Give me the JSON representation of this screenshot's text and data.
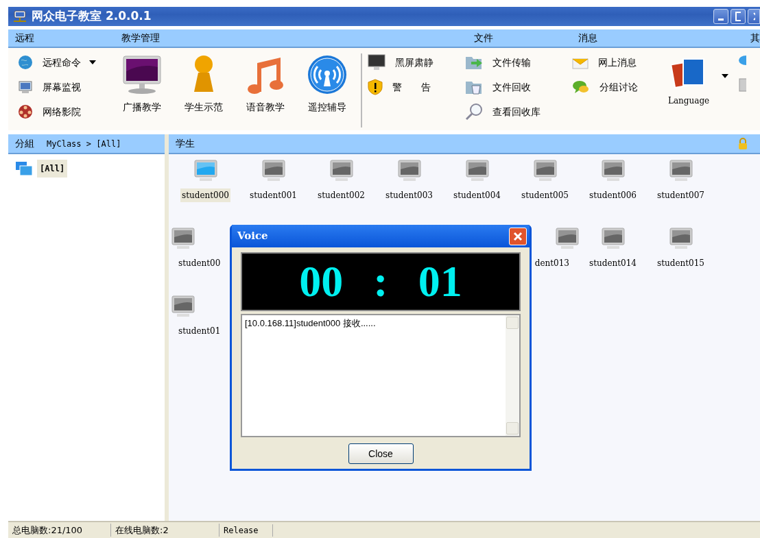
{
  "window": {
    "title": "网众电子教室 2.0.0.1"
  },
  "menu": [
    {
      "label": "远程"
    },
    {
      "label": "教学管理"
    },
    {
      "label": "文件"
    },
    {
      "label": "消息"
    },
    {
      "label": "其"
    }
  ],
  "toolbar": {
    "remote": [
      {
        "label": "远程命令",
        "dropdown": true
      },
      {
        "label": "屏幕监视",
        "dropdown": false
      },
      {
        "label": "网络影院",
        "dropdown": false
      }
    ],
    "teaching": [
      {
        "label": "广播教学"
      },
      {
        "label": "学生示范"
      },
      {
        "label": "语音教学"
      },
      {
        "label": "遥控辅导"
      }
    ],
    "control": [
      {
        "label": "黑屏肃静"
      },
      {
        "label": "警　　告"
      }
    ],
    "file": [
      {
        "label": "文件传输"
      },
      {
        "label": "文件回收"
      },
      {
        "label": "查看回收库"
      }
    ],
    "message": [
      {
        "label": "网上消息"
      },
      {
        "label": "分组讨论"
      }
    ],
    "language": {
      "label": "Language",
      "dropdown": true
    }
  },
  "group_panel": {
    "title": "分組",
    "path": "MyClass > [All]",
    "tree": [
      {
        "label": "[All]",
        "selected": true
      }
    ]
  },
  "student_panel": {
    "title": "学生",
    "rows": [
      [
        {
          "label": "student000",
          "online": true,
          "selected": true
        },
        {
          "label": "student001",
          "online": false,
          "selected": false
        },
        {
          "label": "student002",
          "online": false,
          "selected": false
        },
        {
          "label": "student003",
          "online": false,
          "selected": false
        },
        {
          "label": "student004",
          "online": false,
          "selected": false
        },
        {
          "label": "student005",
          "online": false,
          "selected": false
        },
        {
          "label": "student006",
          "online": false,
          "selected": false
        },
        {
          "label": "student007",
          "online": false,
          "selected": false
        }
      ],
      [
        {
          "label": "student00",
          "online": false,
          "selected": false
        },
        null,
        null,
        null,
        null,
        {
          "label": "dent013",
          "online": false,
          "selected": false
        },
        {
          "label": "student014",
          "online": false,
          "selected": false
        },
        {
          "label": "student015",
          "online": false,
          "selected": false
        }
      ],
      [
        {
          "label": "student01",
          "online": false,
          "selected": false
        }
      ]
    ]
  },
  "dialog": {
    "title": "Voice",
    "timer": {
      "minutes": "00",
      "separator": ":",
      "seconds": "01"
    },
    "log": "[10.0.168.11]student000 接收......",
    "button": "Close"
  },
  "status_bar": [
    "总电脑数:21/100",
    "在线电脑数:2",
    "Release"
  ]
}
